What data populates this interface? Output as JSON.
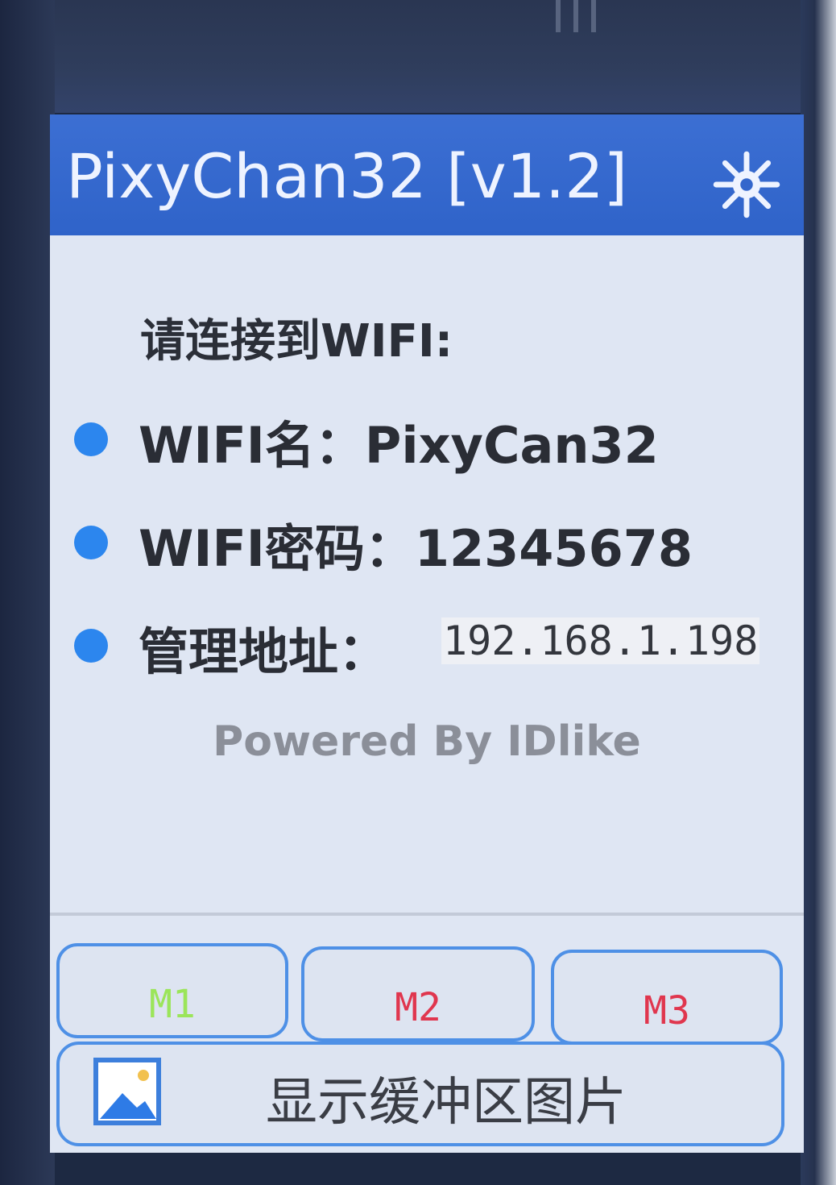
{
  "header": {
    "title": "PixyChan32 [v1.2]",
    "settings_icon": "gear-icon"
  },
  "info": {
    "prompt": "请连接到WIFI:",
    "items": [
      {
        "label": "WIFI名：PixyCan32"
      },
      {
        "label": "WIFI密码：12345678"
      },
      {
        "label": "管理地址：",
        "value": "192.168.1.198"
      }
    ],
    "footer": "Powered By IDlike"
  },
  "buttons": [
    {
      "label": "M1",
      "color": "#9be55a"
    },
    {
      "label": "M2",
      "color": "#e0364e"
    },
    {
      "label": "M3",
      "color": "#e0364e"
    }
  ],
  "action": {
    "label": "显示缓冲区图片",
    "icon": "image-icon"
  },
  "colors": {
    "title_bar": "#2f63c9",
    "bullet": "#2c86ee",
    "button_border": "#4e90e6"
  }
}
